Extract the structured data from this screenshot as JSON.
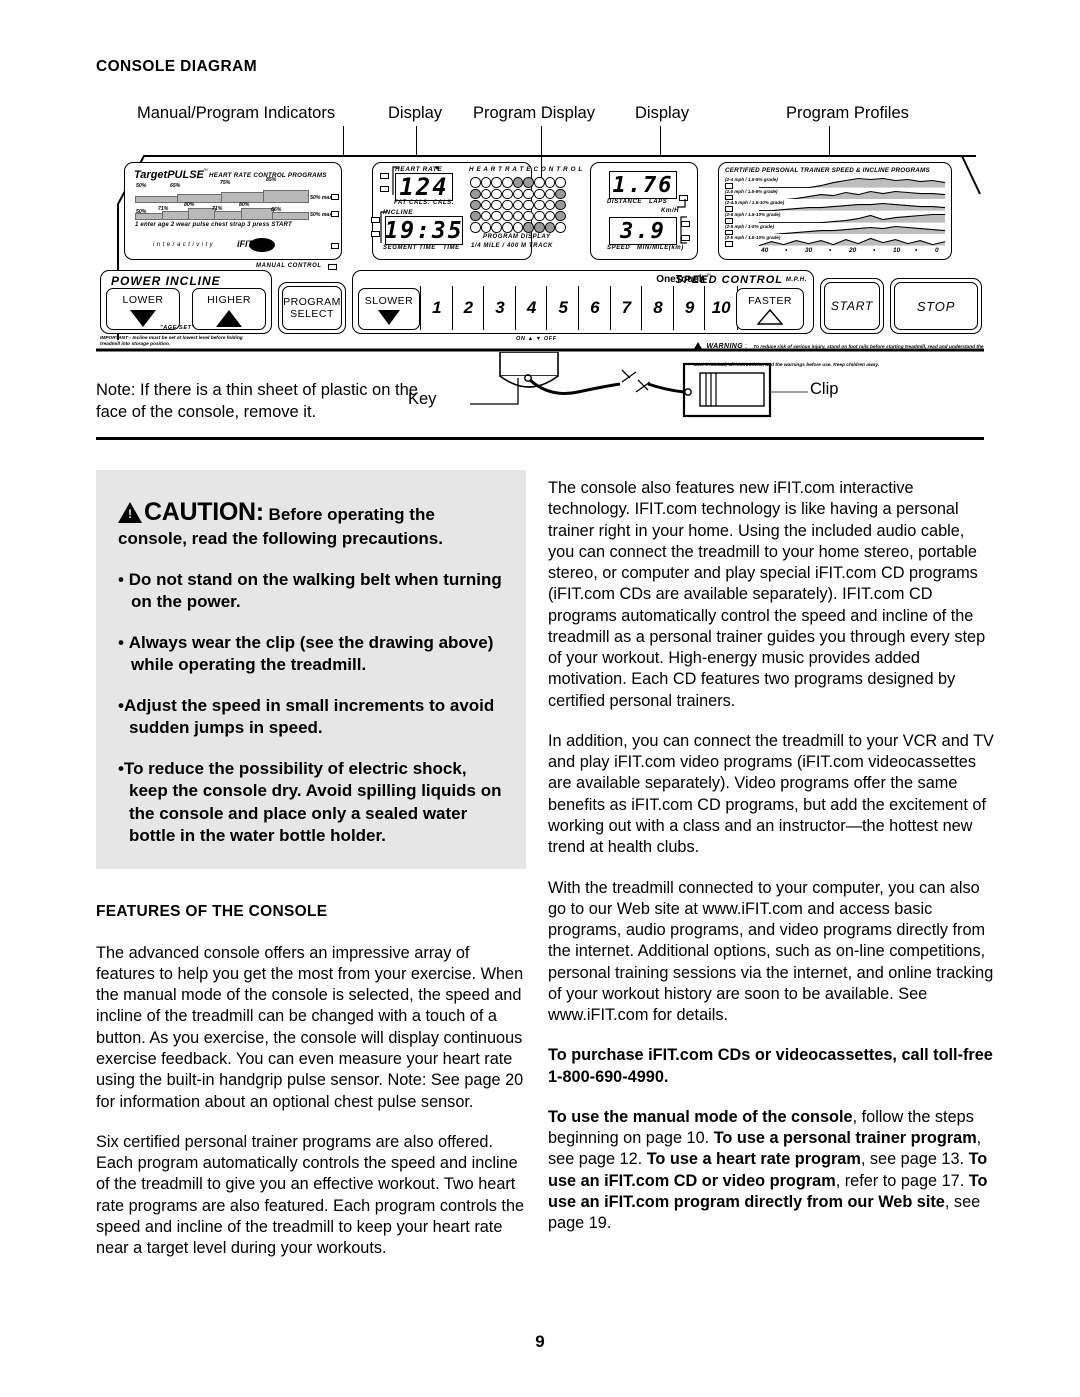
{
  "page": {
    "number": "9",
    "section_title": "CONSOLE DIAGRAM"
  },
  "callouts": [
    {
      "label": "Manual/Program Indicators"
    },
    {
      "label": "Display"
    },
    {
      "label": "Program Display"
    },
    {
      "label": "Display"
    },
    {
      "label": "Program Profiles"
    }
  ],
  "console": {
    "targetpulse": {
      "brand": "TargetPULSE",
      "trademark": "™",
      "subtitle": "HEART RATE CONTROL PROGRAMS",
      "row1_percents": [
        "50%",
        "65%",
        "75%",
        "85%"
      ],
      "row1_max": "50% max.",
      "row2_percents": [
        "50%",
        "71%",
        "80%",
        "71%",
        "80%",
        "66%"
      ],
      "row2_max": "50% max.",
      "steps": "1   enter age   2   wear pulse chest strap   3   press START",
      "interactivity": "i n t e r a c t i v i t y",
      "ifit_logo": "iFIT.com"
    },
    "heart_rate_display": {
      "title": "HEART RATE",
      "heart_icon": "♥",
      "value": "124",
      "label_left": "FAT CALS.",
      "label_right": "CALS."
    },
    "incline_display": {
      "title": "INCLINE",
      "value": "19:35",
      "label_left": "SEGMENT TIME",
      "label_right": "TIME"
    },
    "program_display": {
      "header": "H E A R T   R A T E   C O N T R O L",
      "caption1": "PROGRAM DISPLAY",
      "caption2": "1/4 MILE / 400 M TRACK",
      "columns": 9,
      "rows": 5,
      "lit_dots": [
        [
          0,
          0,
          0,
          0,
          1,
          1,
          0,
          0,
          0
        ],
        [
          1,
          0,
          0,
          0,
          0,
          0,
          0,
          0,
          1
        ],
        [
          1,
          0,
          0,
          0,
          0,
          0,
          0,
          0,
          1
        ],
        [
          1,
          0,
          0,
          0,
          0,
          0,
          0,
          0,
          1
        ],
        [
          0,
          0,
          0,
          0,
          0,
          1,
          1,
          1,
          0
        ]
      ]
    },
    "distance_display": {
      "value": "1.76",
      "label_left": "DISTANCE",
      "label_right": "LAPS"
    },
    "speed_display": {
      "value": "3.9",
      "unit_top": "Km/H",
      "label_left": "SPEED",
      "label_right": "MIN/MILE(km)"
    },
    "manual_control_label": "MANUAL CONTROL",
    "profiles": {
      "title": "CERTIFIED PERSONAL TRAINER SPEED & INCLINE PROGRAMS",
      "items": [
        {
          "name": "(2-4 mph / 1.5-8% grade)"
        },
        {
          "name": "(2.5 mph / 1.5-8% grade)"
        },
        {
          "name": "(2-4.5 mph / 1.5-10% grade)"
        },
        {
          "name": "(2-6 mph / 1.5-10% grade)"
        },
        {
          "name": "(2-5 mph / 1-5% grade)"
        },
        {
          "name": "(2-5 mph / 1.5-10% grade)"
        }
      ],
      "axis": [
        "40",
        "•",
        "30",
        "•",
        "20",
        "•",
        "10",
        "•",
        "0"
      ]
    },
    "buttons": {
      "power_incline_title": "POWER INCLINE",
      "lower": "LOWER",
      "higher": "HIGHER",
      "age_set": "\"AGE SET\"",
      "program_select": "PROGRAM\nSELECT",
      "program_select_line1": "PROGRAM",
      "program_select_line2": "SELECT",
      "slower": "SLOWER",
      "faster": "FASTER",
      "start": "START",
      "stop": "STOP",
      "onetouch": "OneTouch",
      "onetouch_tm": "™",
      "speed_control": "SPEED CONTROL",
      "mph": "M.P.H.",
      "numbers": [
        "1",
        "2",
        "3",
        "4",
        "5",
        "6",
        "7",
        "8",
        "9",
        "10"
      ],
      "on_off": "ON ▲      ▼ OFF"
    },
    "important_note": "IMPORTANT - Incline must be set at lowest level before folding treadmill into storage position.",
    "warning_label": "WARNING",
    "warning_text": "To reduce risk of serious injury, stand on foot rails before starting treadmill, read and understand the user's manual, all instructions, and the warnings before use.  Keep children away."
  },
  "key_clip": {
    "key_label": "Key",
    "clip_label": "Clip"
  },
  "note": "Note: If there is a thin sheet of plastic on the face of the console, remove it.",
  "caution": {
    "icon": "warning-triangle",
    "heading_word": "CAUTION",
    "heading_colon": ":",
    "heading_rest": "Before operating the console, read the following precautions.",
    "bullets": [
      "Do not stand on the walking belt when turning on the power.",
      "Always wear the clip (see the drawing above) while operating the treadmill.",
      "Adjust the speed in small increments to avoid sudden jumps in speed.",
      "To reduce the possibility of electric shock, keep the console dry. Avoid spilling liquids on the console and place only a sealed water bottle in the water bottle holder."
    ]
  },
  "features": {
    "title": "FEATURES OF THE CONSOLE",
    "paragraph1": "The advanced console offers an impressive array of features to help you get the most from your exercise. When the manual mode of the console is selected, the speed and incline of the treadmill can be changed with a touch of a button. As you exercise, the console will display continuous exercise feedback. You can even measure your heart rate using the built-in handgrip pulse sensor. Note: See page 20 for information about an optional chest pulse sensor.",
    "paragraph2": "Six certified personal trainer programs are also offered. Each program automatically controls the speed and incline of the treadmill to give you an effective workout. Two heart rate programs are also featured. Each program controls the speed and incline of the treadmill to keep your heart rate near a target level during your workouts."
  },
  "right_column": {
    "paragraph1": "The console also features new iFIT.com interactive technology. IFIT.com technology is like having a personal trainer right in your home. Using the included audio cable, you can connect the treadmill to your home stereo, portable stereo, or computer and play special iFIT.com CD programs (iFIT.com CDs are available separately). IFIT.com CD programs automatically control the speed and incline of the treadmill as a personal trainer guides you through every step of your workout. High-energy music provides added motivation. Each CD features two programs designed by certified personal trainers.",
    "paragraph2": "In addition, you can connect the treadmill to your VCR and TV and play iFIT.com video programs (iFIT.com videocassettes are available separately). Video programs offer the same benefits as iFIT.com CD programs, but add the excitement of working out with a class and an instructor—the hottest new trend at health clubs.",
    "paragraph3": "With the treadmill connected to your computer, you can also go to our Web site at www.iFIT.com and access basic programs, audio programs, and video programs directly from the internet. Additional options, such as on-line competitions, personal training sessions via the internet, and online tracking of your workout history are soon to be available. See www.iFIT.com for details.",
    "paragraph4_bold": "To purchase iFIT.com CDs or videocassettes, call toll-free 1-800-690-4990.",
    "paragraph5": {
      "b1": "To use the manual mode of the console",
      "t1": ", follow the steps beginning on page 10. ",
      "b2": "To use a personal trainer program",
      "t2": ", see page 12. ",
      "b3": "To use a heart rate program",
      "t3": ", see page 13. ",
      "b4": "To use an iFIT.com CD or video program",
      "t4": ", refer to page 17. ",
      "b5": "To use an iFIT.com program directly from our Web site",
      "t5": ", see page 19."
    }
  }
}
